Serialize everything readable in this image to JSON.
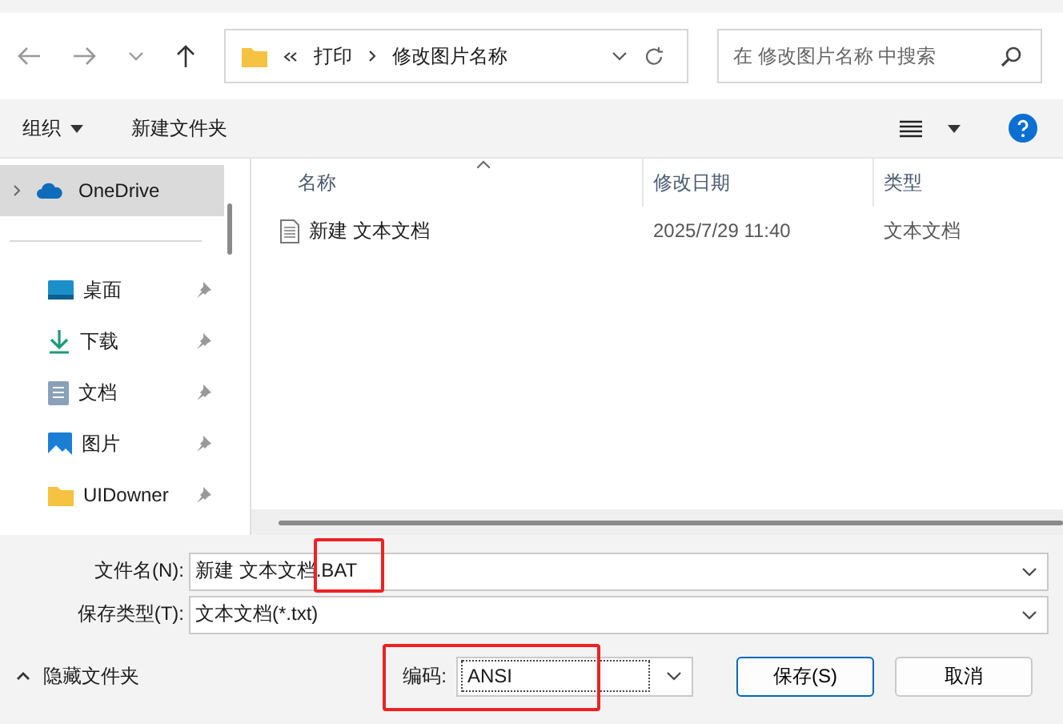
{
  "nav": {
    "path": [
      "打印",
      "修改图片名称"
    ],
    "search": {
      "placeholder": "在 修改图片名称 中搜索"
    }
  },
  "toolbar": {
    "items": [
      "组织",
      "新建文件夹"
    ]
  },
  "sidebar": {
    "items": [
      {
        "label": "OneDrive",
        "kind": "cloud",
        "selected": true,
        "pinned": false
      },
      {
        "label": "桌面",
        "kind": "desktop",
        "selected": false,
        "pinned": true
      },
      {
        "label": "下载",
        "kind": "download",
        "selected": false,
        "pinned": true
      },
      {
        "label": "文档",
        "kind": "document",
        "selected": false,
        "pinned": true
      },
      {
        "label": "图片",
        "kind": "image",
        "selected": false,
        "pinned": true
      },
      {
        "label": "UIDowner",
        "kind": "folder",
        "selected": false,
        "pinned": true
      }
    ]
  },
  "table": {
    "columns": [
      "名称",
      "修改日期",
      "类型"
    ],
    "rows": [
      {
        "name": "新建 文本文档",
        "modified": "2025/7/29 11:40",
        "type": "文本文档"
      }
    ]
  },
  "form": {
    "filename_label": "文件名(N):",
    "filename": "新建 文本文档.BAT",
    "type_label": "保存类型(T):",
    "type": "文本文档(*.txt)",
    "encoding_label": "编码:",
    "encoding": "ANSI"
  },
  "hide_folders": "隐藏文件夹",
  "buttons": [
    "保存(S)",
    "取消"
  ]
}
